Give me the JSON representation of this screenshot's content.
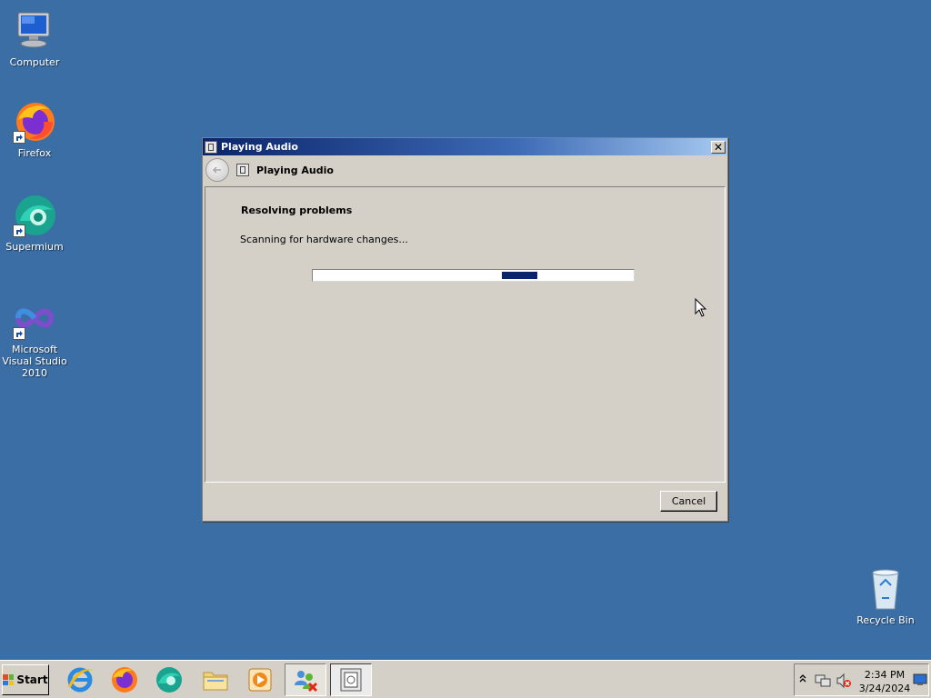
{
  "desktop": {
    "icons": [
      {
        "label": "Computer"
      },
      {
        "label": "Firefox"
      },
      {
        "label": "Supermium"
      },
      {
        "label": "Microsoft Visual Studio 2010"
      },
      {
        "label": "Recycle Bin"
      }
    ]
  },
  "dialog": {
    "title": "Playing Audio",
    "close_label": "✕",
    "nav_title": "Playing Audio",
    "heading": "Resolving problems",
    "status": "Scanning for hardware changes...",
    "progress_marquee": true,
    "cancel_label": "Cancel"
  },
  "taskbar": {
    "start_label": "Start",
    "items": [
      "internet-explorer",
      "firefox",
      "supermium",
      "file-explorer",
      "media-player",
      "network-people",
      "playing-audio"
    ],
    "clock": {
      "time": "2:34 PM",
      "date": "3/24/2024"
    }
  },
  "colors": {
    "desktop": "#3a6ea5",
    "window_face": "#d4d0c8",
    "title_gradient_start": "#0a246a",
    "progress_fill": "#0a246a"
  }
}
